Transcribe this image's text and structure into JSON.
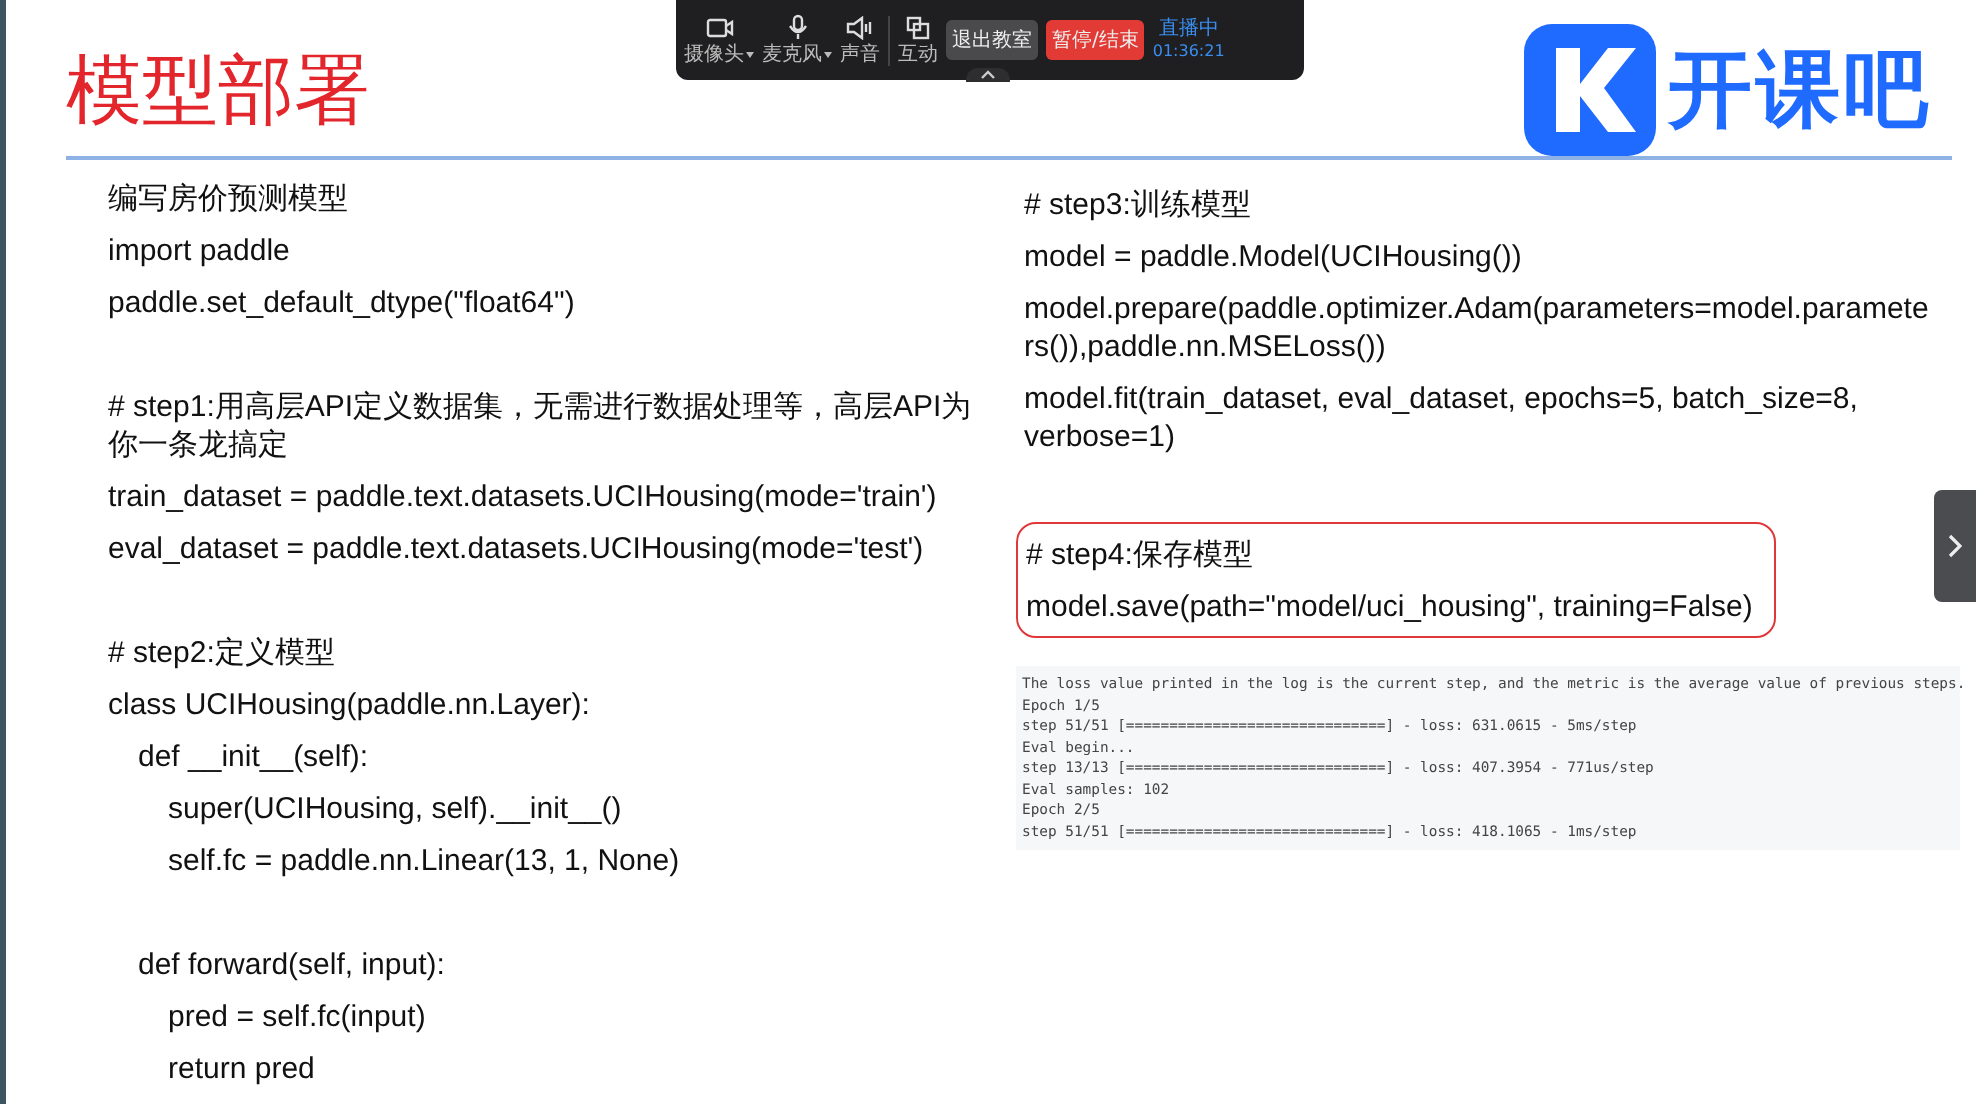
{
  "toolbar": {
    "items": [
      {
        "label": "摄像头",
        "dropdown": true
      },
      {
        "label": "麦克风",
        "dropdown": true
      },
      {
        "label": "声音",
        "dropdown": false
      },
      {
        "label": "互动",
        "dropdown": false
      }
    ],
    "buttons": [
      {
        "label": "退出教室",
        "kind": "exit"
      },
      {
        "label": "暂停/结束",
        "kind": "stop"
      }
    ],
    "live_status": "直播中",
    "timer": "01:36:21"
  },
  "slide": {
    "title": "模型部署",
    "logo_text": "开课吧",
    "left_blocks": [
      {
        "lines": [
          {
            "text": "编写房价预测模型"
          },
          {
            "text": "import paddle"
          },
          {
            "text": "paddle.set_default_dtype(\"float64\")"
          }
        ]
      },
      {
        "lines": [
          {
            "text": "# step1:用高层API定义数据集，无需进行数据处理等，高层API为你一条龙搞定"
          },
          {
            "text": "train_dataset = paddle.text.datasets.UCIHousing(mode='train')"
          },
          {
            "text": "eval_dataset = paddle.text.datasets.UCIHousing(mode='test')"
          }
        ]
      },
      {
        "lines": [
          {
            "text": "# step2:定义模型"
          },
          {
            "text": "class UCIHousing(paddle.nn.Layer):",
            "children": [
              {
                "text": "def __init__(self):",
                "children": [
                  {
                    "text": "super(UCIHousing, self).__init__()"
                  },
                  {
                    "text": "self.fc = paddle.nn.Linear(13, 1, None)"
                  }
                ]
              },
              {
                "text": "def forward(self, input):",
                "children": [
                  {
                    "text": "pred = self.fc(input)"
                  },
                  {
                    "text": "return pred"
                  }
                ]
              }
            ]
          }
        ]
      }
    ],
    "right_blocks": [
      {
        "highlighted": false,
        "lines": [
          {
            "text": "# step3:训练模型"
          },
          {
            "text": "model = paddle.Model(UCIHousing())"
          },
          {
            "text": "model.prepare(paddle.optimizer.Adam(parameters=model.parameters()),paddle.nn.MSELoss())"
          },
          {
            "text": "model.fit(train_dataset, eval_dataset, epochs=5, batch_size=8, verbose=1)"
          }
        ]
      },
      {
        "highlighted": true,
        "lines": [
          {
            "text": "# step4:保存模型"
          },
          {
            "text": "model.save(path=\"model/uci_housing\", training=False)"
          }
        ]
      }
    ],
    "console_log": [
      "The loss value printed in the log is the current step, and the metric is the average value of previous steps.",
      "Epoch 1/5",
      "step 51/51 [==============================] - loss: 631.0615 - 5ms/step",
      "Eval begin...",
      "step 13/13 [==============================] - loss: 407.3954 - 771us/step",
      "Eval samples: 102",
      "Epoch 2/5",
      "step 51/51 [==============================] - loss: 418.1065 - 1ms/step"
    ]
  }
}
